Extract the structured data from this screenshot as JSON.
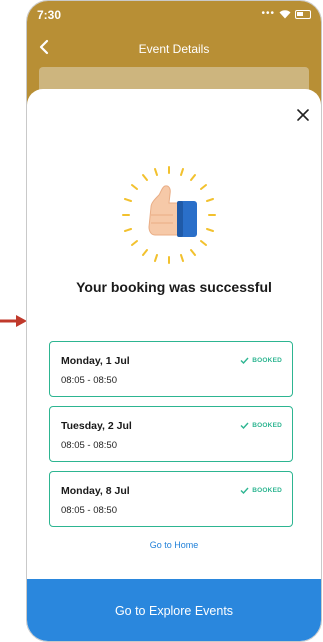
{
  "status_bar": {
    "time": "7:30",
    "signal_dots": "•••"
  },
  "header": {
    "title": "Event Details"
  },
  "modal": {
    "headline": "Your booking was successful",
    "bookings": [
      {
        "date": "Monday, 1 Jul",
        "time": "08:05 - 08:50",
        "status": "BOOKED"
      },
      {
        "date": "Tuesday, 2 Jul",
        "time": "08:05 - 08:50",
        "status": "BOOKED"
      },
      {
        "date": "Monday, 8 Jul",
        "time": "08:05 - 08:50",
        "status": "BOOKED"
      }
    ],
    "go_home_label": "Go to Home",
    "cta_label": "Go to Explore Events"
  },
  "colors": {
    "header_bg": "#b88f35",
    "booked_green": "#2db591",
    "link_blue": "#1e7fd8",
    "cta_blue": "#2a87dd",
    "annotation_red": "#c0392b"
  },
  "icons": [
    "back-arrow-icon",
    "wifi-icon",
    "battery-icon",
    "close-icon",
    "thumbs-up-icon",
    "check-icon"
  ]
}
